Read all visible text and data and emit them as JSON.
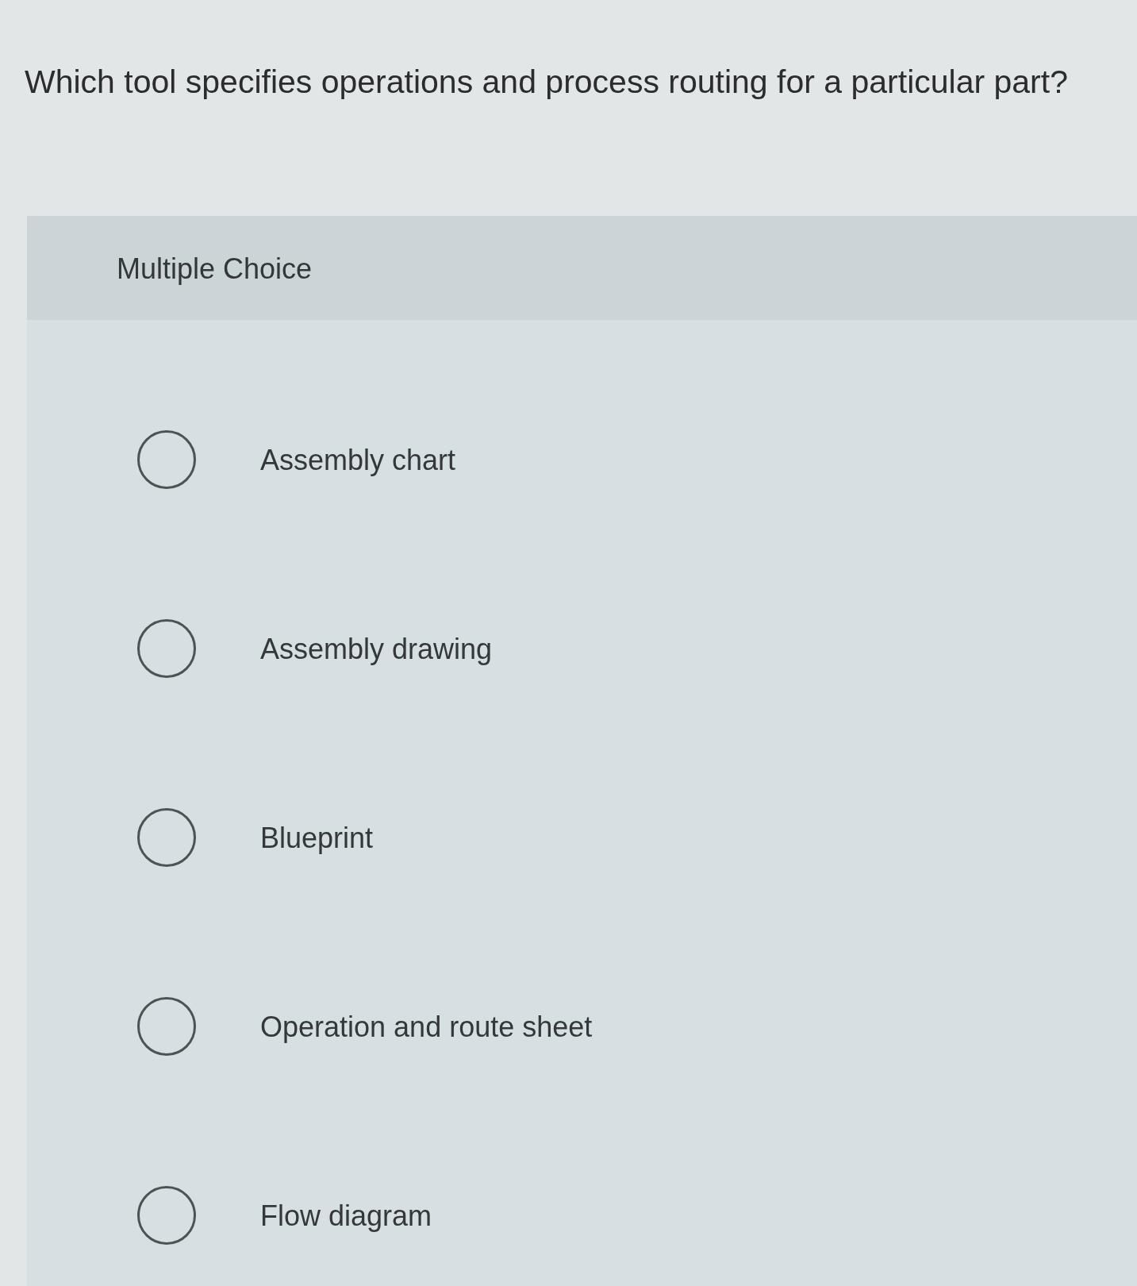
{
  "question": "Which tool specifies operations and process routing for a particular part?",
  "panel": {
    "heading": "Multiple Choice"
  },
  "options": [
    {
      "label": "Assembly chart",
      "selected": false
    },
    {
      "label": "Assembly drawing",
      "selected": false
    },
    {
      "label": "Blueprint",
      "selected": false
    },
    {
      "label": "Operation and route sheet",
      "selected": false
    },
    {
      "label": "Flow diagram",
      "selected": false
    }
  ]
}
